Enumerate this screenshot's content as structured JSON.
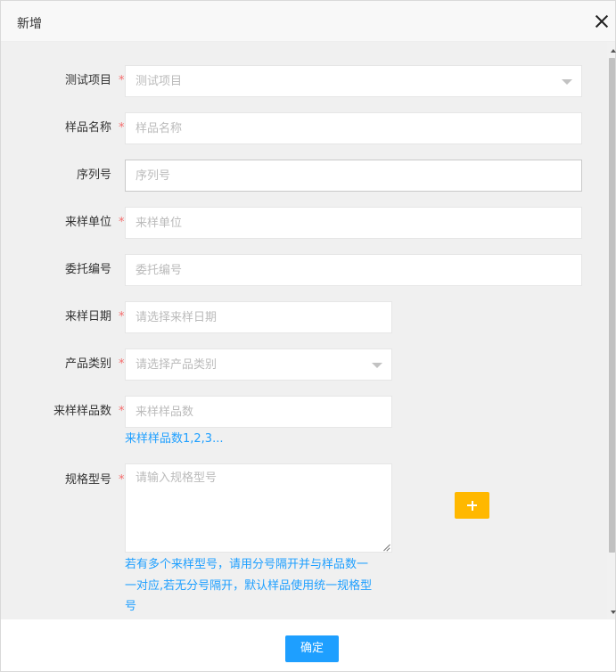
{
  "dialog": {
    "title": "新增"
  },
  "form": {
    "test_item": {
      "label": "测试项目",
      "required": "*",
      "placeholder": "测试项目"
    },
    "sample_name": {
      "label": "样品名称",
      "required": "*",
      "placeholder": "样品名称"
    },
    "serial_no": {
      "label": "序列号",
      "placeholder": "序列号"
    },
    "sample_unit": {
      "label": "来样单位",
      "required": "*",
      "placeholder": "来样单位"
    },
    "entrust_no": {
      "label": "委托编号",
      "placeholder": "委托编号"
    },
    "sample_date": {
      "label": "来样日期",
      "required": "*",
      "placeholder": "请选择来样日期"
    },
    "product_type": {
      "label": "产品类别",
      "required": "*",
      "placeholder": "请选择产品类别"
    },
    "sample_count": {
      "label": "来样样品数",
      "required": "*",
      "placeholder": "来样样品数",
      "hint": "来样样品数1,2,3..."
    },
    "spec_model": {
      "label": "规格型号",
      "required": "*",
      "placeholder": "请输入规格型号",
      "hint_lines": [
        "若有多个来样型号，请用分号隔开并与样品数一",
        "一对应,若无分号隔开，默认样品使用统一规格型",
        "号"
      ],
      "add_icon": "plus-icon"
    }
  },
  "footer": {
    "confirm_label": "确定"
  },
  "colors": {
    "accent": "#1e9fff",
    "warning": "#ffb800",
    "required": "#f56c6c"
  }
}
